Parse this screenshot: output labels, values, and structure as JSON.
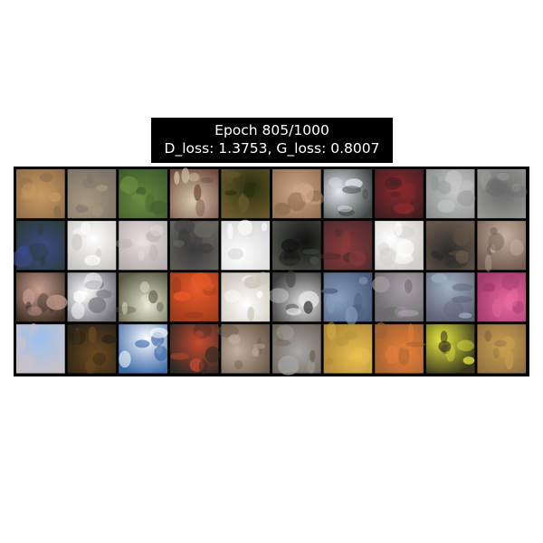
{
  "figure": {
    "title_line1": "Epoch 805/1000",
    "title_line2": "D_loss: 1.3753, G_loss: 0.8007",
    "background": "#ffffff",
    "grid_border_color": "#000000",
    "grid_rows": 4,
    "grid_cols": 10
  },
  "samples": [
    [
      "#8a6a48",
      "#7c7468",
      "#3e5a2c",
      "#6e4a3a",
      "#6a5a2e",
      "#8c6a4e",
      "#3c4440",
      "#3a1e1e",
      "#8e9090",
      "#9a9a98"
    ],
    [
      "#2c3a30",
      "#c8c4c0",
      "#b0aaa8",
      "#6a6660",
      "#d8d8d8",
      "#4c5048",
      "#4a2a2e",
      "#d0ccc8",
      "#6a5a4c",
      "#6e5a50"
    ],
    [
      "#3a2c22",
      "#6a6a72",
      "#5a5a40",
      "#9a3a1c",
      "#cac4b8",
      "#3c3c3c",
      "#4a5c7a",
      "#6c6a6e",
      "#5c6070",
      "#a03a6a"
    ],
    [
      "#c8c2c8",
      "#2a2218",
      "#3c6aa8",
      "#2c2a24",
      "#6a5a4a",
      "#6a5e52",
      "#b08a38",
      "#a06030",
      "#3a3a1e",
      "#8a6a40"
    ]
  ],
  "sample_accents": [
    [
      "#c89a60",
      "#a89880",
      "#6a8a40",
      "#d8c8b0",
      "#2a3010",
      "#d0a888",
      "#e8e8f0",
      "#8a2a30",
      "#c8c8c8",
      "#6a6a6a"
    ],
    [
      "#3a4c8a",
      "#ffffff",
      "#e8e0e0",
      "#3a3a3a",
      "#ffffff",
      "#101010",
      "#8a3a3a",
      "#ffffff",
      "#2a2a2a",
      "#c8b0a0"
    ],
    [
      "#c8a090",
      "#ffffff",
      "#e8e8d8",
      "#e85a2a",
      "#ffffff",
      "#e8e8e8",
      "#8aa0c0",
      "#a8a0a8",
      "#a0b0c0",
      "#e86aa0"
    ],
    [
      "#a0c0e8",
      "#6a4a20",
      "#ffffff",
      "#c84a30",
      "#c0b0a0",
      "#a8a8a8",
      "#e8c050",
      "#e8803a",
      "#e8e840",
      "#c8a050"
    ]
  ]
}
